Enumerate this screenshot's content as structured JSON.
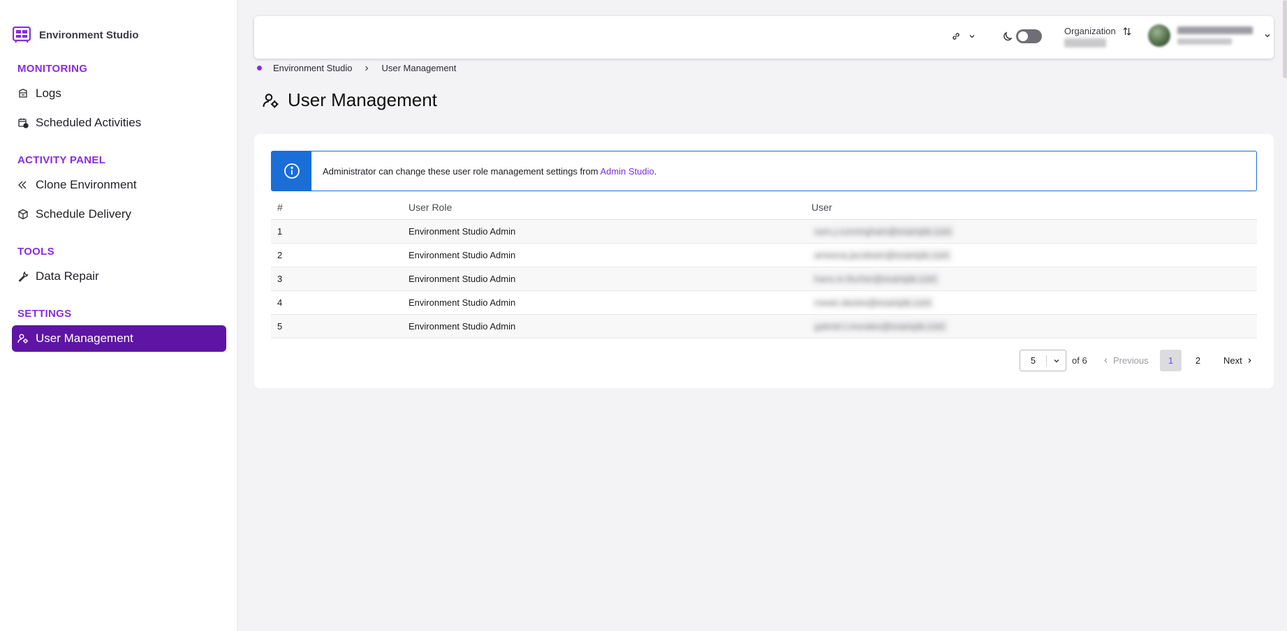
{
  "app": {
    "title": "Environment Studio"
  },
  "sidebar": {
    "sections": [
      {
        "title": "MONITORING",
        "items": [
          {
            "label": "Logs",
            "icon": "logs-icon"
          },
          {
            "label": "Scheduled Activities",
            "icon": "calendar-clock-icon"
          }
        ]
      },
      {
        "title": "ACTIVITY PANEL",
        "items": [
          {
            "label": "Clone Environment",
            "icon": "clone-icon"
          },
          {
            "label": "Schedule Delivery",
            "icon": "package-icon"
          }
        ]
      },
      {
        "title": "TOOLS",
        "items": [
          {
            "label": "Data Repair",
            "icon": "wrench-icon"
          }
        ]
      },
      {
        "title": "SETTINGS",
        "items": [
          {
            "label": "User Management",
            "icon": "user-cog-icon",
            "active": true
          }
        ]
      }
    ]
  },
  "topbar": {
    "organization_label": "Organization"
  },
  "breadcrumb": [
    "Environment Studio",
    "User Management"
  ],
  "page": {
    "title": "User Management"
  },
  "alert": {
    "text": "Administrator can change these user role management settings from ",
    "link": "Admin Studio",
    "suffix": "."
  },
  "table": {
    "headers": [
      "#",
      "User Role",
      "User"
    ],
    "rows": [
      {
        "num": "1",
        "role": "Environment Studio Admin",
        "user": "sam.j.cunningham@example.com"
      },
      {
        "num": "2",
        "role": "Environment Studio Admin",
        "user": "ameena.jacobsen@example.com"
      },
      {
        "num": "3",
        "role": "Environment Studio Admin",
        "user": "hans.m.fischer@example.com"
      },
      {
        "num": "4",
        "role": "Environment Studio Admin",
        "user": "rowan.davies@example.com"
      },
      {
        "num": "5",
        "role": "Environment Studio Admin",
        "user": "gabriel.t.morales@example.com"
      }
    ]
  },
  "pagination": {
    "page_size": "5",
    "of_total": "of 6",
    "previous": "Previous",
    "pages": [
      "1",
      "2"
    ],
    "current": "1",
    "next": "Next"
  },
  "colors": {
    "accent": "#5e15a3",
    "section": "#8a2be2",
    "info": "#1a6ed8"
  }
}
